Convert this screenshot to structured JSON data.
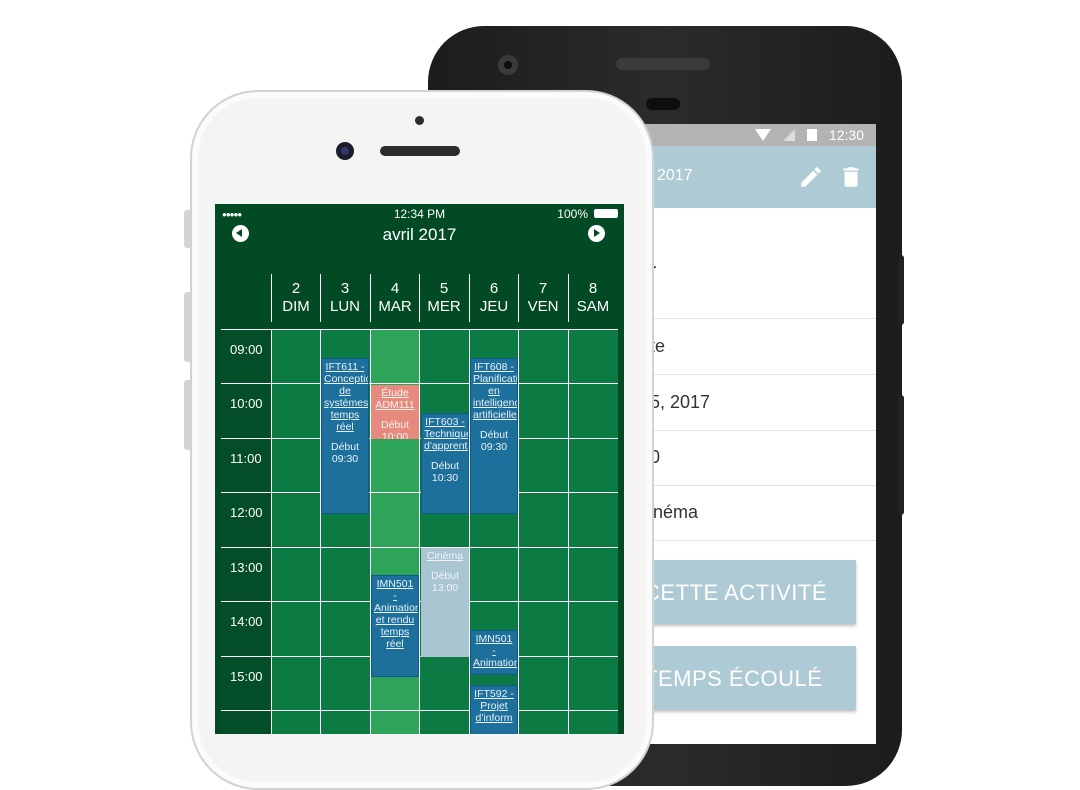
{
  "android": {
    "status_time": "12:30",
    "toolbar_title": "2017",
    "icons": [
      "pencil-icon",
      "trash-icon"
    ],
    "title": "na",
    "rows": [
      "ète",
      "05, 2017",
      "00",
      "cinéma"
    ],
    "buttons": [
      "CETTE ACTIVITÉ",
      "TEMPS ÉCOULÉ"
    ],
    "colors": {
      "accent": "#aecad5",
      "status_bar": "#b3b3b3"
    }
  },
  "ios": {
    "status": {
      "time": "12:34 PM",
      "battery": "100%"
    },
    "month": "avril 2017",
    "days": [
      {
        "num": "2",
        "name": "DIM"
      },
      {
        "num": "3",
        "name": "LUN"
      },
      {
        "num": "4",
        "name": "MAR"
      },
      {
        "num": "5",
        "name": "MER"
      },
      {
        "num": "6",
        "name": "JEU"
      },
      {
        "num": "7",
        "name": "VEN"
      },
      {
        "num": "8",
        "name": "SAM"
      }
    ],
    "times": [
      "09:00",
      "10:00",
      "11:00",
      "12:00",
      "13:00",
      "14:00",
      "15:00"
    ],
    "events": [
      {
        "title": "IFT611 - Conception de systèmes temps réel",
        "start": "Début 09:30"
      },
      {
        "title": "Étude ADM111",
        "start": "Début 10:00"
      },
      {
        "title": "IFT603 - Techniques d'apprentissage",
        "start": "Début 10:30"
      },
      {
        "title": "IFT608 - Planification en intelligence artificielle",
        "start": "Début 09:30"
      },
      {
        "title": "Cinéma",
        "start": "Début 13:00"
      },
      {
        "title": "IMN501 - Animation et rendu temps réel",
        "start": ""
      },
      {
        "title": "IMN501 - Animation",
        "start": ""
      },
      {
        "title": "IFT592 - Projet d'inform",
        "start": ""
      }
    ],
    "colors": {
      "header": "#024a24",
      "grid": "#0b7a43",
      "today": "#2ea45a",
      "event": "#1d6f9c",
      "event_alt": "#e68a7e",
      "event_past": "#a9c5d2"
    }
  }
}
